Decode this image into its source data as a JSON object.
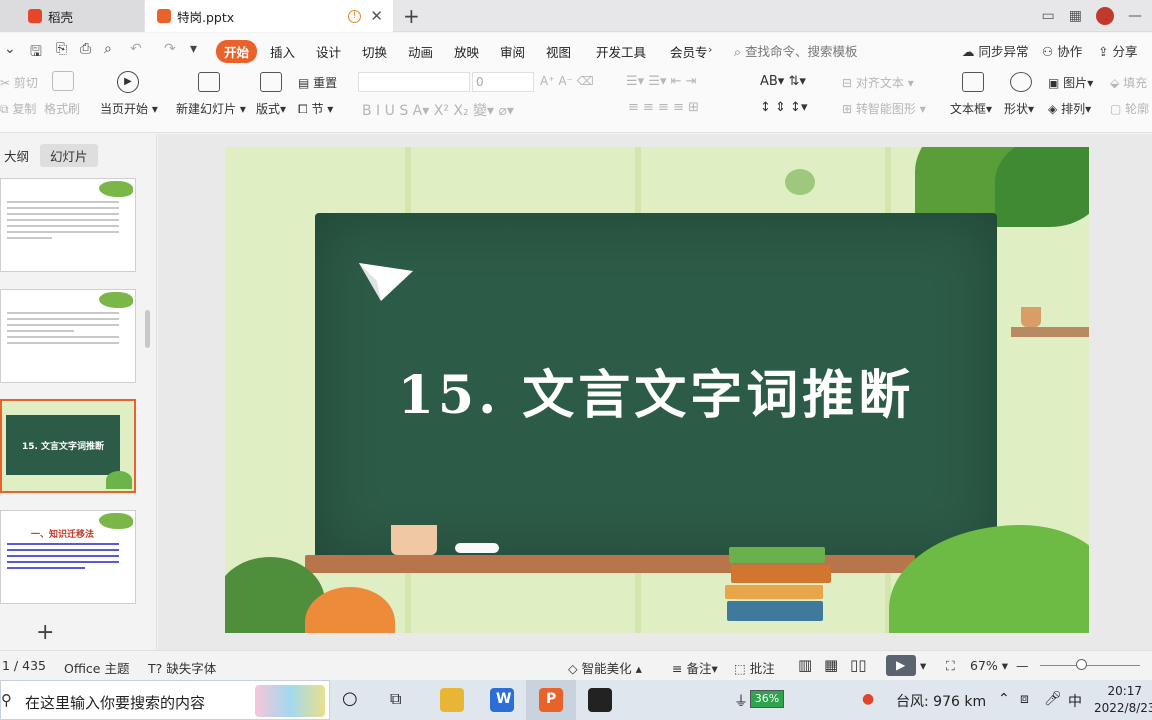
{
  "tabs": [
    {
      "label": "稻壳",
      "color": "#e8462a"
    },
    {
      "label": "特岗.pptx",
      "color": "#e8622a"
    }
  ],
  "menu": {
    "items": [
      "开始",
      "插入",
      "设计",
      "切换",
      "动画",
      "放映",
      "审阅",
      "视图",
      "开发工具",
      "会员专"
    ],
    "active": "开始",
    "search_placeholder": "查找命令、搜索模板",
    "sync": "同步异常",
    "collab": "协作",
    "share": "分享"
  },
  "ribbon": {
    "cut": "剪切",
    "copy": "复制",
    "format_painter": "格式刷",
    "play_from_current": "当页开始",
    "new_slide": "新建幻灯片",
    "layout": "版式",
    "reset": "重置",
    "section": "节",
    "font_size": "0",
    "align_text": "对齐文本",
    "smart_shape": "转智能图形",
    "textbox": "文本框",
    "shape": "形状",
    "picture": "图片",
    "arrange": "排列",
    "fill": "填充",
    "outline": "轮廓"
  },
  "pane": {
    "tabs": [
      "大纲",
      "幻灯片"
    ],
    "active_tab": "幻灯片",
    "selected_thumb_title": "15. 文言文字词推断",
    "thumb4_title": "一、知识迁移法"
  },
  "slide": {
    "title": "15. 文言文字词推断"
  },
  "status": {
    "page": "1 / 435",
    "theme": "Office 主题",
    "missing_font": "缺失字体",
    "beautify": "智能美化",
    "notes": "备注",
    "comment": "批注",
    "zoom": "67%"
  },
  "taskbar": {
    "search_placeholder": "在这里输入你要搜索的内容",
    "battery": "36%",
    "weather": "台风: 976 km",
    "ime": "中",
    "time": "20:17",
    "date": "2022/8/23"
  },
  "colors": {
    "accent": "#e8622a",
    "board": "#2c5b47",
    "slide_bg": "#dfeec3"
  }
}
